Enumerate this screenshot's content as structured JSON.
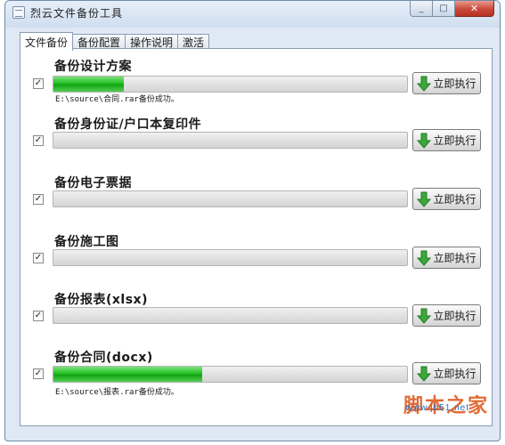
{
  "window": {
    "title": "烈云文件备份工具",
    "close_glyph": "✕",
    "max_glyph": "□",
    "min_glyph": "_"
  },
  "tabs": [
    {
      "label": "文件备份",
      "active": true
    },
    {
      "label": "备份配置",
      "active": false
    },
    {
      "label": "操作说明",
      "active": false
    },
    {
      "label": "激活",
      "active": false
    }
  ],
  "run_label": "立即执行",
  "tasks": [
    {
      "title": "备份设计方案",
      "checked": true,
      "progress": 0.2,
      "status": "E:\\source\\合同.rar备份成功。"
    },
    {
      "title": "备份身份证/户口本复印件",
      "checked": true,
      "progress": 0,
      "status": ""
    },
    {
      "title": "备份电子票据",
      "checked": true,
      "progress": 0,
      "status": ""
    },
    {
      "title": "备份施工图",
      "checked": true,
      "progress": 0,
      "status": ""
    },
    {
      "title": "备份报表(xlsx)",
      "checked": true,
      "progress": 0,
      "status": ""
    },
    {
      "title": "备份合同(docx)",
      "checked": true,
      "progress": 0.42,
      "status": "E:\\source\\报表.rar备份成功。"
    }
  ],
  "check_glyph": "✓",
  "watermark": {
    "text": "脚本之家",
    "url": "www.jb51.net"
  },
  "colors": {
    "progress_fill": "#23c023",
    "arrow": "#3aa83a",
    "titlebar": "#d7e4f2"
  }
}
